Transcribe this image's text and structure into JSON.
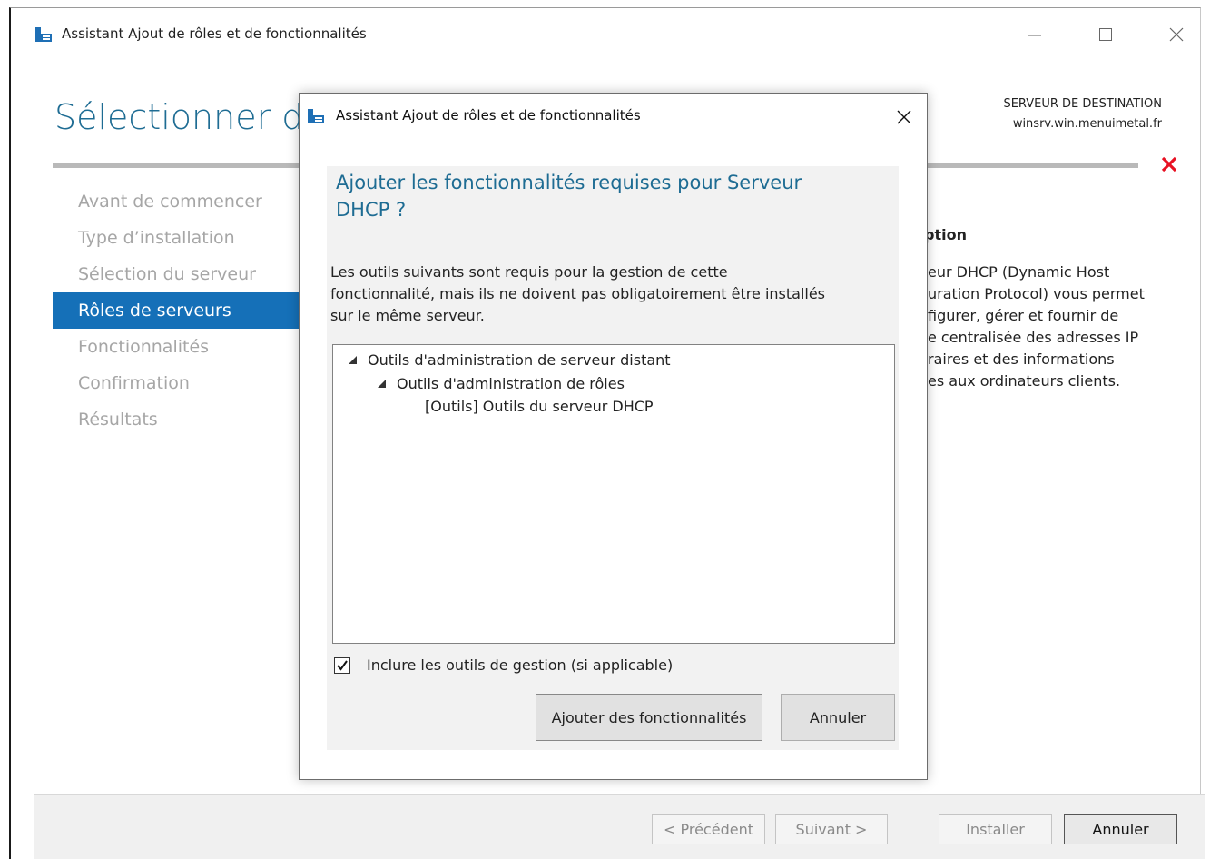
{
  "main_window": {
    "title": "Assistant Ajout de rôles et de fonctionnalités",
    "page_title": "Sélectionner des",
    "destination_label": "SERVEUR DE DESTINATION",
    "destination_server": "winsrv.win.menuimetal.fr",
    "nav_items": [
      {
        "label": "Avant de commencer",
        "state": "disabled"
      },
      {
        "label": "Type d’installation",
        "state": "disabled"
      },
      {
        "label": "Sélection du serveur",
        "state": "disabled"
      },
      {
        "label": "Rôles de serveurs",
        "state": "active"
      },
      {
        "label": "Fonctionnalités",
        "state": "disabled"
      },
      {
        "label": "Confirmation",
        "state": "disabled"
      },
      {
        "label": "Résultats",
        "state": "disabled"
      }
    ],
    "description_header": "ption",
    "description_lines": [
      "eur DHCP (Dynamic Host",
      "uration Protocol) vous permet",
      "figurer, gérer et fournir de",
      "e centralisée des adresses IP",
      "raires et des informations",
      "es aux ordinateurs clients."
    ],
    "buttons": {
      "previous": "< Précédent",
      "next": "Suivant >",
      "install": "Installer",
      "cancel": "Annuler"
    },
    "icons": {
      "app": "server-manager-icon",
      "minimize": "minimize-icon",
      "maximize": "maximize-icon",
      "close": "close-icon",
      "error": "error-x-icon"
    }
  },
  "dialog": {
    "title": "Assistant Ajout de rôles et de fonctionnalités",
    "heading_line1": "Ajouter les fonctionnalités requises pour Serveur",
    "heading_line2": "DHCP ?",
    "body_line1": "Les outils suivants sont requis pour la gestion de cette",
    "body_line2": "fonctionnalité, mais ils ne doivent pas obligatoirement être installés",
    "body_line3": "sur le même serveur.",
    "tree": [
      {
        "label": "Outils d'administration de serveur distant",
        "level": 0,
        "expanded": true
      },
      {
        "label": "Outils d'administration de rôles",
        "level": 1,
        "expanded": true
      },
      {
        "label": "[Outils] Outils du serveur DHCP",
        "level": 2
      }
    ],
    "checkbox_label": "Inclure les outils de gestion (si applicable)",
    "checkbox_checked": true,
    "add_button": "Ajouter des fonctionnalités",
    "cancel_button": "Annuler"
  },
  "colors": {
    "accent": "#1e6c93",
    "nav_active": "#1570b8",
    "error": "#e81123"
  }
}
